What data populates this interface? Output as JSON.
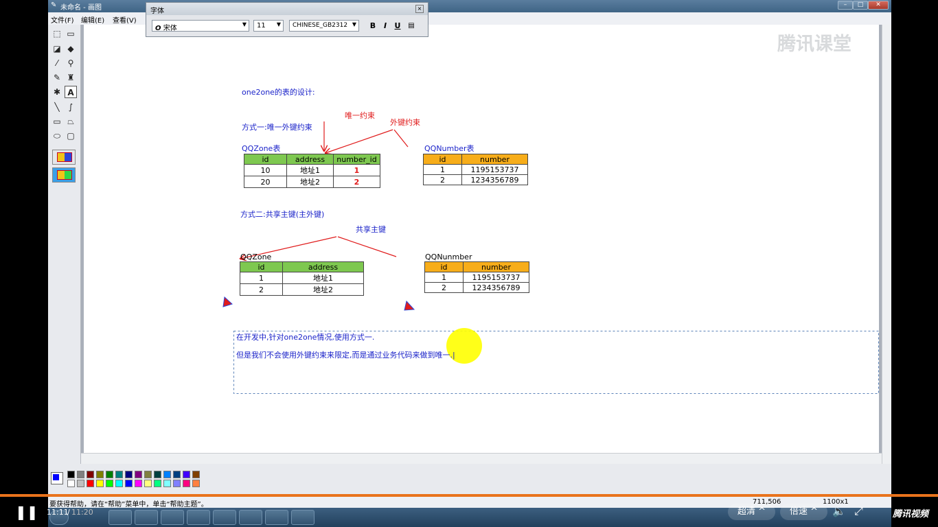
{
  "window": {
    "title": "未命名 - 画图"
  },
  "menu": [
    "文件(F)",
    "编辑(E)",
    "查看(V)"
  ],
  "font_dialog": {
    "title": "字体",
    "font_name": "宋体",
    "font_size": "11",
    "charset": "CHINESE_GB2312",
    "bold": "B",
    "italic": "I",
    "underline": "U"
  },
  "watermark": "腾讯课堂",
  "canvas": {
    "heading": "one2one的表的设计:",
    "way1": "方式一:唯一外键约束",
    "label_unique": "唯一约束",
    "label_fk": "外键约束",
    "t1_name": "QQZone表",
    "t1_headers": [
      "id",
      "address",
      "number_id"
    ],
    "t1_rows": [
      [
        "10",
        "地址1",
        "1"
      ],
      [
        "20",
        "地址2",
        "2"
      ]
    ],
    "t2_name": "QQNumber表",
    "t2_headers": [
      "id",
      "number"
    ],
    "t2_rows": [
      [
        "1",
        "1195153737"
      ],
      [
        "2",
        "1234356789"
      ]
    ],
    "way2": "方式二:共享主键(主外键)",
    "label_shared": "共享主键",
    "t3_name": "QQZone",
    "t3_headers": [
      "id",
      "address"
    ],
    "t3_rows": [
      [
        "1",
        "地址1"
      ],
      [
        "2",
        "地址2"
      ]
    ],
    "t4_name": "QQNunmber",
    "t4_headers": [
      "id",
      "number"
    ],
    "t4_rows": [
      [
        "1",
        "1195153737"
      ],
      [
        "2",
        "1234356789"
      ]
    ],
    "note1": "在开发中,针对one2one情况,使用方式一.",
    "note2": "但是我们不会使用外键约束来限定,而是通过业务代码来做到唯一.|"
  },
  "status": {
    "help": "要获得帮助，请在“帮助”菜单中，单击“帮助主题”。",
    "coords": "711,506",
    "size": "1100x1"
  },
  "player": {
    "time": "11:11",
    "duration": "11:20",
    "quality": "超清",
    "speed": "倍速",
    "brand": "腾讯视频"
  },
  "colors": {
    "accent": "#e9731c",
    "green": "#7ec850",
    "orange": "#f7ad1a"
  }
}
